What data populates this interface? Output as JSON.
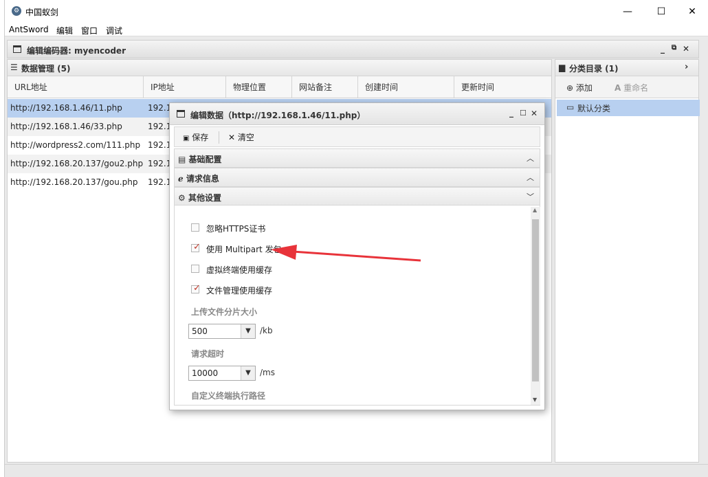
{
  "window": {
    "title": "中国蚁剑",
    "minimize_glyph": "—",
    "maximize_glyph": "☐",
    "close_glyph": "✕"
  },
  "menu": [
    "AntSword",
    "编辑",
    "窗口",
    "调试"
  ],
  "panel": {
    "title": "编辑编码器: myencoder",
    "controls": [
      "_",
      "⧉",
      "✕"
    ]
  },
  "grid": {
    "title": "数据管理 (5)",
    "columns": [
      "URL地址",
      "IP地址",
      "物理位置",
      "网站备注",
      "创建时间",
      "更新时间"
    ],
    "rows": [
      {
        "url": "http://192.168.1.46/11.php",
        "ip": "192.1",
        "selected": true
      },
      {
        "url": "http://192.168.1.46/33.php",
        "ip": "192.1",
        "selected": false
      },
      {
        "url": "http://wordpress2.com/111.php",
        "ip": "192.1",
        "selected": false
      },
      {
        "url": "http://192.168.20.137/gou2.php",
        "ip": "192.1",
        "selected": false
      },
      {
        "url": "http://192.168.20.137/gou.php",
        "ip": "192.1",
        "selected": false
      }
    ]
  },
  "category": {
    "title": "分类目录 (1)",
    "add_label": "添加",
    "rename_label": "重命名",
    "items": [
      {
        "label": "默认分类",
        "selected": true
      }
    ]
  },
  "dialog": {
    "title": "编辑数据（http://192.168.1.46/11.php）",
    "controls": [
      "_",
      "☐",
      "✕"
    ],
    "save_label": "保存",
    "clear_label": "清空",
    "sections": [
      {
        "label": "基础配置",
        "expanded": false
      },
      {
        "label": "请求信息",
        "expanded": false
      },
      {
        "label": "其他设置",
        "expanded": true
      }
    ],
    "options": [
      {
        "label": "忽略HTTPS证书",
        "checked": false
      },
      {
        "label": "使用 Multipart 发包",
        "checked": true
      },
      {
        "label": "虚拟终端使用缓存",
        "checked": false
      },
      {
        "label": "文件管理使用缓存",
        "checked": true
      }
    ],
    "upload_chunk": {
      "label": "上传文件分片大小",
      "value": "500",
      "unit": "/kb"
    },
    "timeout": {
      "label": "请求超时",
      "value": "10000",
      "unit": "/ms"
    },
    "terminal_path": {
      "label": "自定义终端执行路径"
    }
  },
  "colors": {
    "selection": "#b8d0f0",
    "arrow": "#e8333a",
    "check": "#c0392b"
  }
}
